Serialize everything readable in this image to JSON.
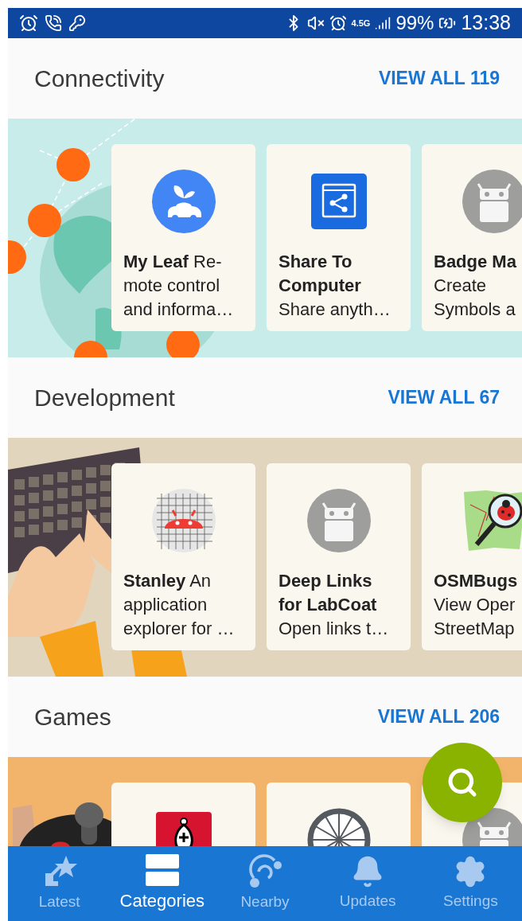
{
  "status_bar": {
    "network": "4.5G",
    "battery": "99%",
    "time": "13:38"
  },
  "sections": [
    {
      "title": "Connectivity",
      "view_all": "VIEW ALL 119",
      "kind": "globe",
      "apps": [
        {
          "kind": "leaf",
          "lines": [
            "**My Leaf** Re-",
            "mote control",
            "and informa…"
          ]
        },
        {
          "kind": "share",
          "lines": [
            "**Share To**",
            "**Computer**",
            "Share anyth…"
          ]
        },
        {
          "kind": "robot",
          "lines": [
            "**Badge Ma**",
            "Create",
            "Symbols a"
          ]
        }
      ]
    },
    {
      "title": "Development",
      "view_all": "VIEW ALL 67",
      "kind": "keyboard",
      "apps": [
        {
          "kind": "grid-robot",
          "lines": [
            "**Stanley** An",
            "application",
            "explorer for …"
          ]
        },
        {
          "kind": "robot",
          "lines": [
            "**Deep Links**",
            "**for LabCoat**",
            "Open links t…"
          ]
        },
        {
          "kind": "map-bug",
          "lines": [
            "**OSMBugs**",
            "View Oper",
            "StreetMap"
          ]
        }
      ]
    },
    {
      "title": "Games",
      "view_all": "VIEW ALL 206",
      "kind": "joystick",
      "apps": [
        {
          "kind": "chess"
        },
        {
          "kind": "wheel"
        },
        {
          "kind": "robot"
        }
      ]
    }
  ],
  "nav": [
    {
      "label": "Latest",
      "kind": "latest",
      "selected": false
    },
    {
      "label": "Categories",
      "kind": "categories",
      "selected": true
    },
    {
      "label": "Nearby",
      "kind": "nearby",
      "selected": false
    },
    {
      "label": "Updates",
      "kind": "bell",
      "selected": false
    },
    {
      "label": "Settings",
      "kind": "gear",
      "selected": false
    }
  ]
}
